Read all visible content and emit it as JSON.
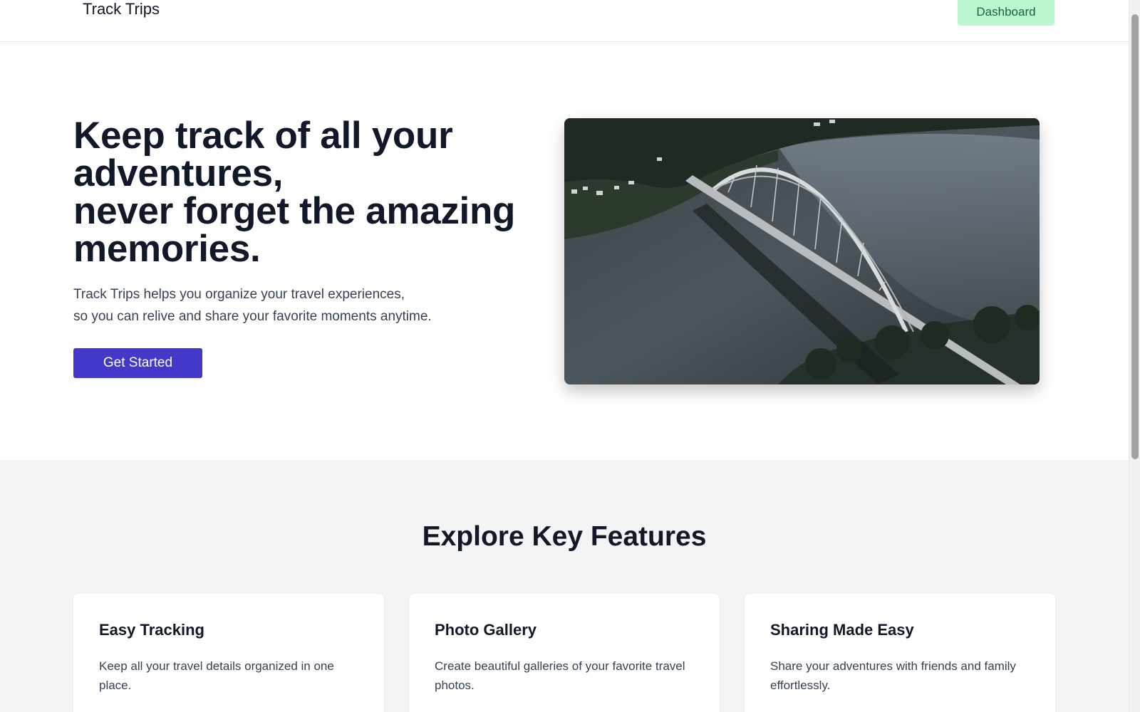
{
  "header": {
    "brand": "Track Trips",
    "dashboard_label": "Dashboard"
  },
  "hero": {
    "title_lines": [
      "Keep track of all your",
      "adventures,",
      "never forget the amazing",
      "memories."
    ],
    "subtitle_lines": [
      "Track Trips helps you organize your travel experiences,",
      "so you can relive and share your favorite moments anytime."
    ],
    "cta_label": "Get Started",
    "image_alt": "Aerial view of an arch bridge over a lake"
  },
  "features": {
    "title": "Explore Key Features",
    "cards": [
      {
        "title": "Easy Tracking",
        "text": "Keep all your travel details organized in one place."
      },
      {
        "title": "Photo Gallery",
        "text": "Create beautiful galleries of your favorite travel photos."
      },
      {
        "title": "Sharing Made Easy",
        "text": "Share your adventures with friends and family effortlessly."
      }
    ]
  },
  "colors": {
    "primary": "#4338ca",
    "dashboard_bg": "#bbf7d0",
    "section_bg": "#f3f4f6",
    "text": "#111827"
  }
}
